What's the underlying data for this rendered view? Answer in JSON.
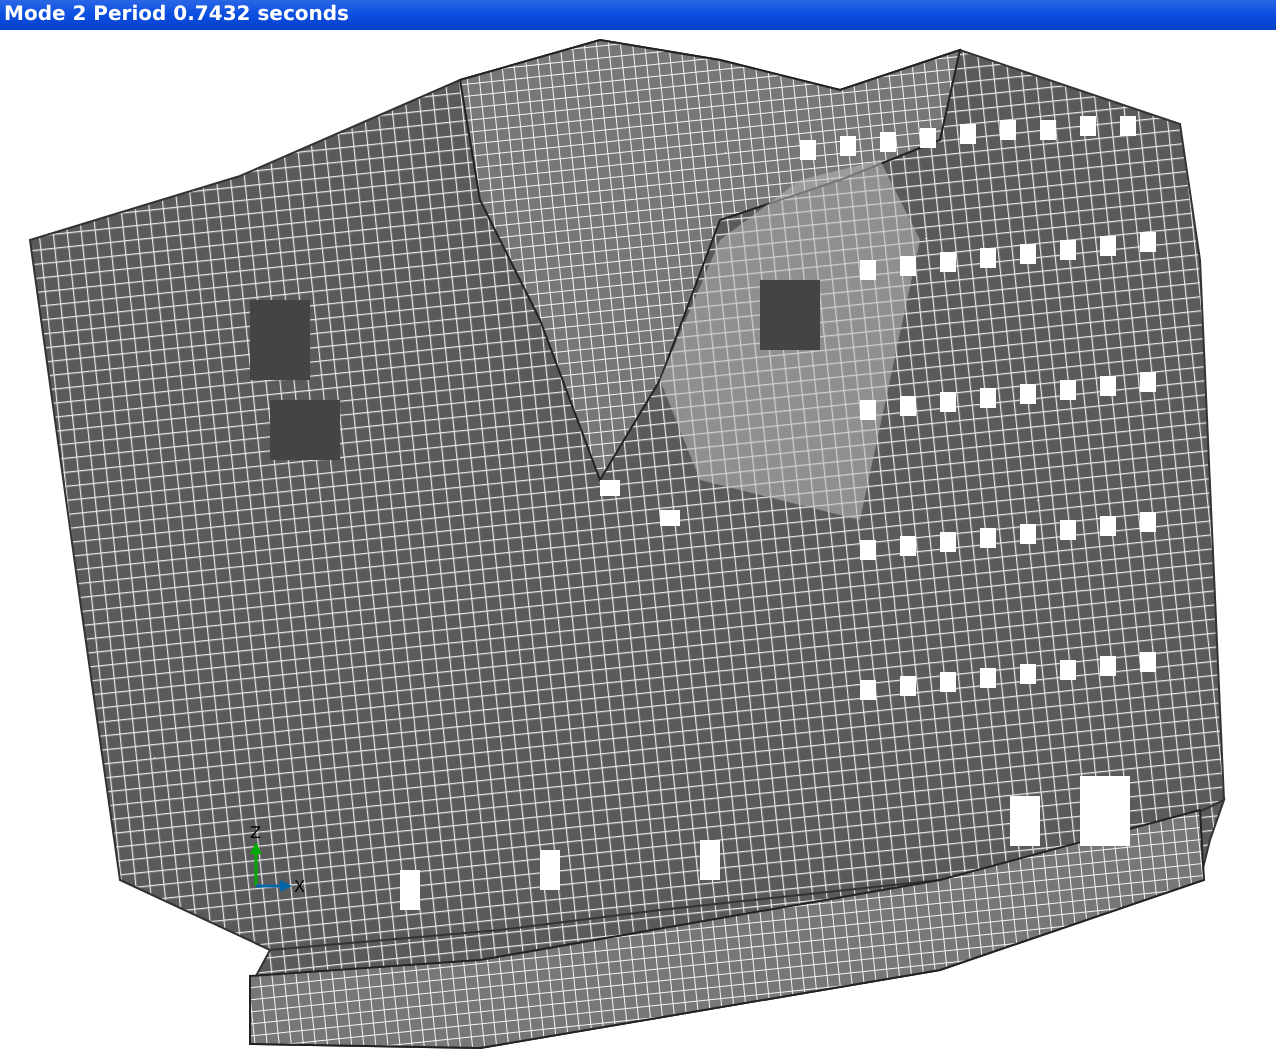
{
  "window": {
    "title": "Mode 2 Period 0.7432 seconds"
  },
  "axes": [
    {
      "kind": "vertical",
      "label": "Z"
    },
    {
      "kind": "horizontal",
      "label": "X"
    }
  ]
}
